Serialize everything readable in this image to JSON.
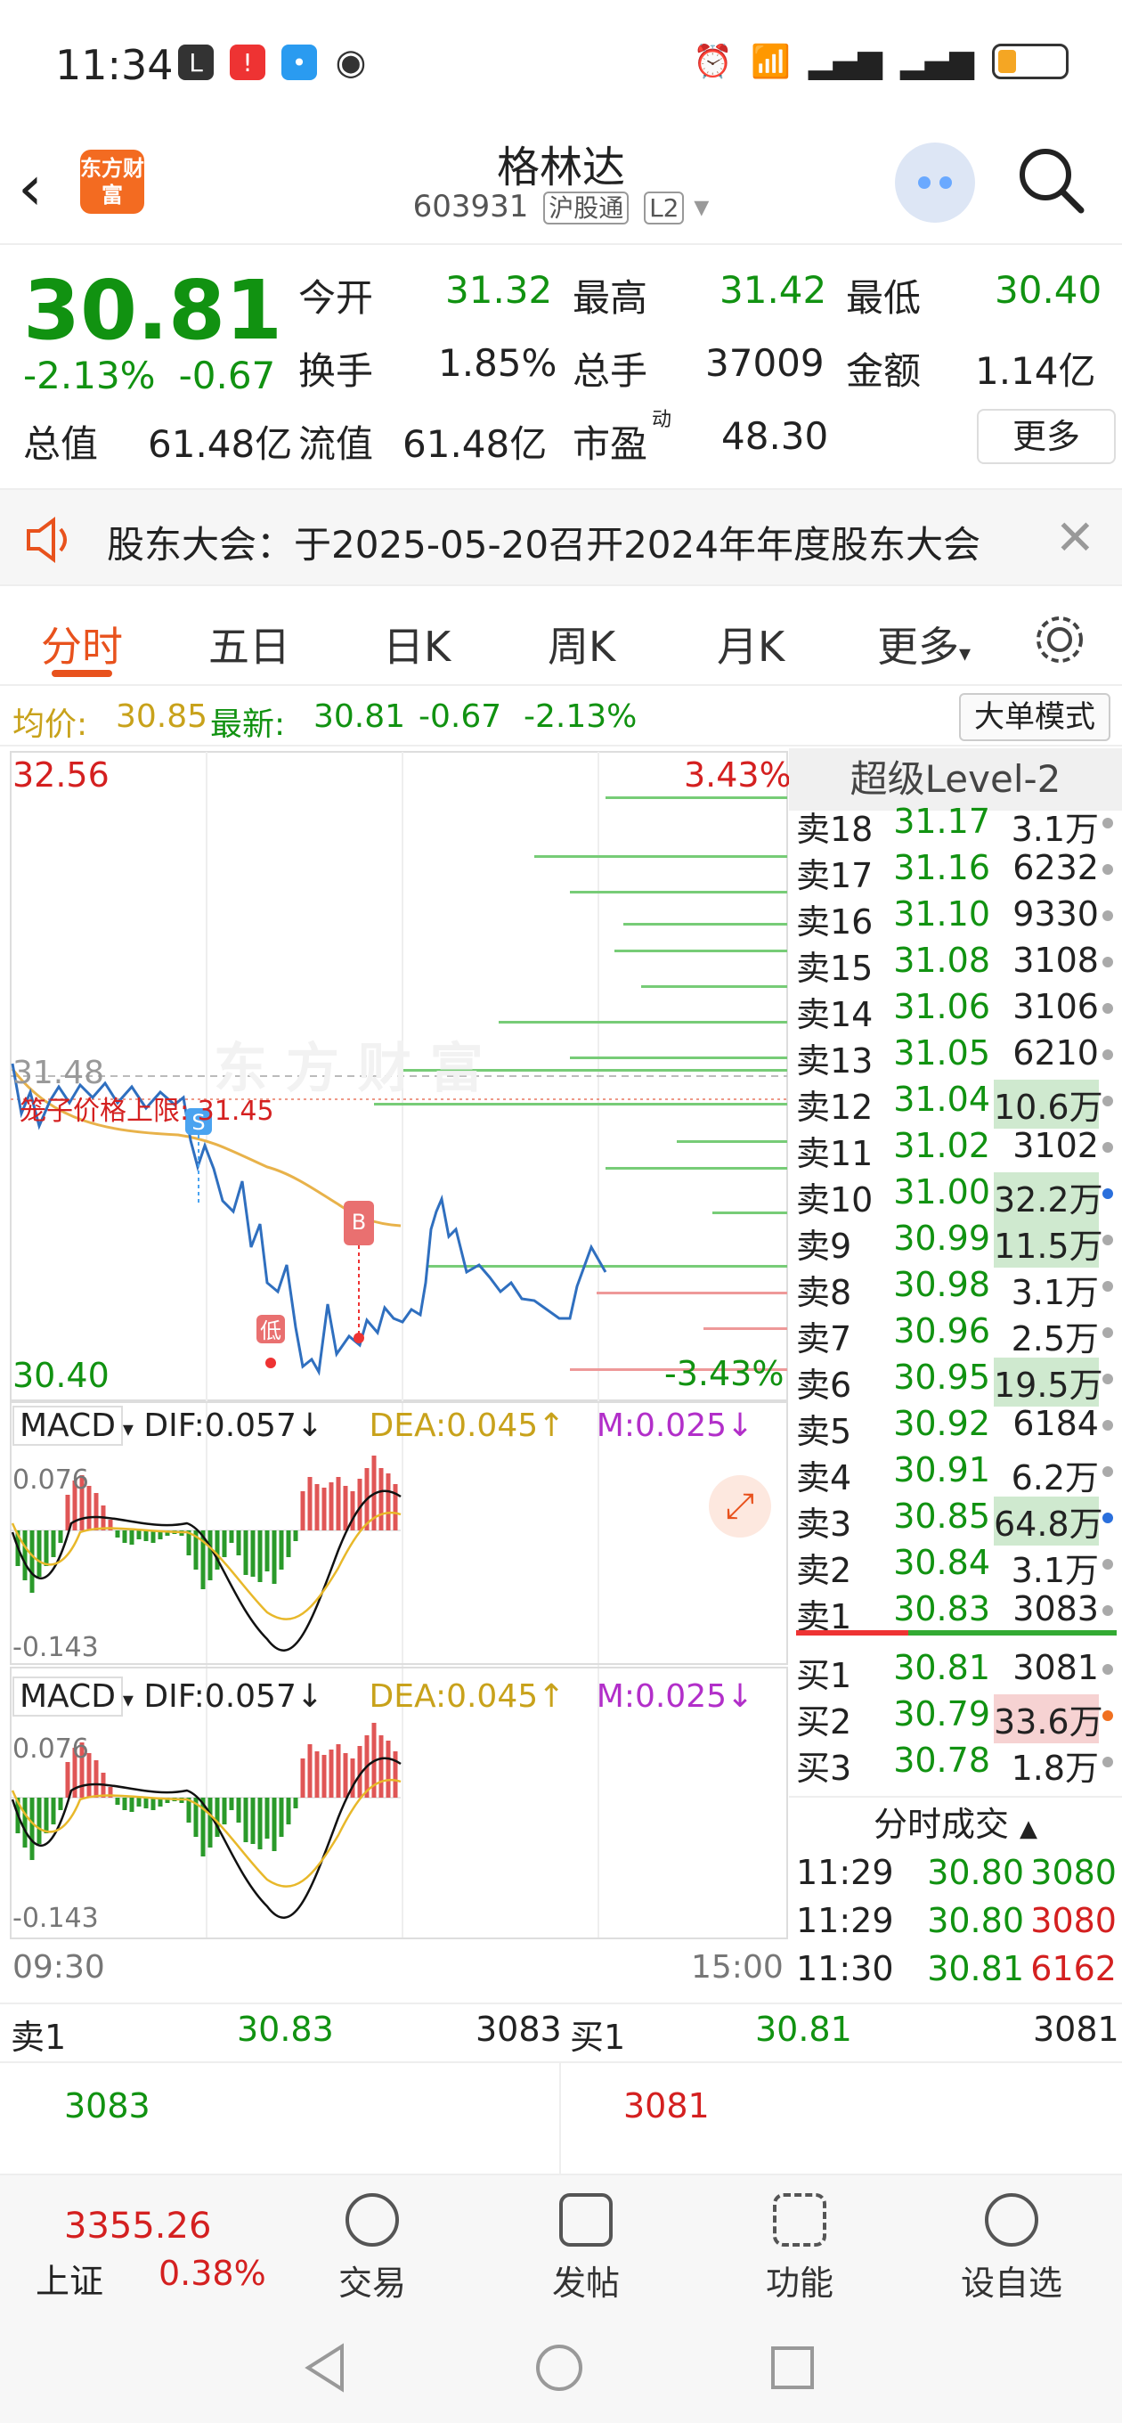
{
  "status": {
    "time": "11:34"
  },
  "header": {
    "title": "格林达",
    "code": "603931",
    "tag1": "沪股通",
    "tag2": "L2",
    "logo": "东方财富"
  },
  "quote": {
    "price": "30.81",
    "change_pct": "-2.13%",
    "change": "-0.67",
    "open_label": "今开",
    "open": "31.32",
    "high_label": "最高",
    "high": "31.42",
    "low_label": "最低",
    "low": "30.40",
    "turn_label": "换手",
    "turn": "1.85%",
    "vol_label": "总手",
    "vol": "37009",
    "amt_label": "金额",
    "amt": "1.14亿",
    "mcap_label": "总值",
    "mcap": "61.48亿",
    "float_label": "流值",
    "float": "61.48亿",
    "pe_label": "市盈",
    "pe_sup": "动",
    "pe": "48.30",
    "more": "更多"
  },
  "notice": {
    "text": "股东大会：于2025-05-20召开2024年年度股东大会"
  },
  "tabs": [
    "分时",
    "五日",
    "日K",
    "周K",
    "月K",
    "更多"
  ],
  "avg": {
    "avg_label": "均价:",
    "avg": "30.85",
    "latest_label": "最新:",
    "latest": "30.81",
    "chg": "-0.67",
    "pct": "-2.13%",
    "mode_btn": "大单模式"
  },
  "chart": {
    "ymax": "32.56",
    "ymin": "30.40",
    "pct_top": "3.43%",
    "pct_bot": "-3.43%",
    "mid": "31.48",
    "cage": "笼子价格上限: 31.45",
    "t_start": "09:30",
    "t_end": "15:00",
    "low_tag": "低",
    "sell_tag": "S",
    "buy_tag": "B",
    "macd1": {
      "label": "MACD",
      "dif": "DIF:0.057↓",
      "dea": "DEA:0.045↑",
      "m": "M:0.025↓",
      "top": "0.076",
      "bot": "-0.143"
    },
    "macd2": {
      "label": "MACD",
      "dif": "DIF:0.057↓",
      "dea": "DEA:0.045↑",
      "m": "M:0.025↓",
      "top": "0.076",
      "bot": "-0.143"
    }
  },
  "orderbook": {
    "title": "超级Level-2",
    "asks": [
      {
        "l": "卖18",
        "p": "31.17",
        "v": "3.1万"
      },
      {
        "l": "卖17",
        "p": "31.16",
        "v": "6232"
      },
      {
        "l": "卖16",
        "p": "31.10",
        "v": "9330"
      },
      {
        "l": "卖15",
        "p": "31.08",
        "v": "3108"
      },
      {
        "l": "卖14",
        "p": "31.06",
        "v": "3106"
      },
      {
        "l": "卖13",
        "p": "31.05",
        "v": "6210"
      },
      {
        "l": "卖12",
        "p": "31.04",
        "v": "10.6万"
      },
      {
        "l": "卖11",
        "p": "31.02",
        "v": "3102"
      },
      {
        "l": "卖10",
        "p": "31.00",
        "v": "32.2万"
      },
      {
        "l": "卖9",
        "p": "30.99",
        "v": "11.5万"
      },
      {
        "l": "卖8",
        "p": "30.98",
        "v": "3.1万"
      },
      {
        "l": "卖7",
        "p": "30.96",
        "v": "2.5万"
      },
      {
        "l": "卖6",
        "p": "30.95",
        "v": "19.5万"
      },
      {
        "l": "卖5",
        "p": "30.92",
        "v": "6184"
      },
      {
        "l": "卖4",
        "p": "30.91",
        "v": "6.2万"
      },
      {
        "l": "卖3",
        "p": "30.85",
        "v": "64.8万"
      },
      {
        "l": "卖2",
        "p": "30.84",
        "v": "3.1万"
      },
      {
        "l": "卖1",
        "p": "30.83",
        "v": "3083"
      }
    ],
    "bids": [
      {
        "l": "买1",
        "p": "30.81",
        "v": "3081"
      },
      {
        "l": "买2",
        "p": "30.79",
        "v": "33.6万"
      },
      {
        "l": "买3",
        "p": "30.78",
        "v": "1.8万"
      }
    ],
    "trades_title": "分时成交",
    "trades": [
      {
        "t": "11:29",
        "p": "30.80",
        "v": "3080"
      },
      {
        "t": "11:29",
        "p": "30.80",
        "v": "3080"
      },
      {
        "t": "11:30",
        "p": "30.81",
        "v": "6162"
      }
    ]
  },
  "bottom": {
    "s1_label": "卖1",
    "s1_price": "30.83",
    "s1_vol": "3083",
    "s1_sub": "3083",
    "b1_label": "买1",
    "b1_price": "30.81",
    "b1_vol": "3081",
    "b1_sub": "3081"
  },
  "nav": {
    "index_value": "3355.26",
    "index_name": "上证",
    "index_pct": "0.38%",
    "items": [
      "交易",
      "发帖",
      "功能",
      "设自选"
    ]
  }
}
